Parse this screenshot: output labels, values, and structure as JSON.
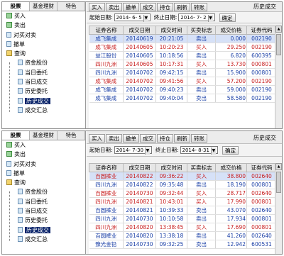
{
  "top": {
    "left_tabs": [
      "股票",
      "基金理财",
      "特色"
    ],
    "tree": [
      {
        "label": "买入",
        "level": 0,
        "icon": "buy-icon"
      },
      {
        "label": "卖出",
        "level": 0,
        "icon": "sell-icon"
      },
      {
        "label": "对买对卖",
        "level": 0,
        "icon": "doc-icon"
      },
      {
        "label": "撤单",
        "level": 0,
        "icon": "doc-icon"
      },
      {
        "label": "查询",
        "level": 0,
        "icon": "folder-icon"
      },
      {
        "label": "资金股份",
        "level": 1,
        "icon": "doc-icon"
      },
      {
        "label": "当日委托",
        "level": 1,
        "icon": "doc-icon"
      },
      {
        "label": "当日成交",
        "level": 1,
        "icon": "doc-icon"
      },
      {
        "label": "历史委托",
        "level": 1,
        "icon": "doc-icon"
      },
      {
        "label": "历史成交",
        "level": 1,
        "icon": "doc-icon",
        "selected": true
      },
      {
        "label": "成交汇总",
        "level": 1,
        "icon": "doc-icon"
      }
    ],
    "toolbar": [
      "买入",
      "卖出",
      "撤单",
      "成交",
      "持仓",
      "刷新",
      "转账"
    ],
    "title": "历史成交",
    "filter": {
      "start_label": "起始日期:",
      "start_date": "2014- 6- 5",
      "end_label": "终止日期:",
      "end_date": "2014- 7- 2",
      "query": "确定"
    },
    "columns": [
      "证券名称",
      "成交日期",
      "成交时间",
      "买卖标志",
      "成交价格",
      "证券代码"
    ],
    "rows": [
      [
        "成飞集成",
        "20140619",
        "20:21:05",
        "卖出",
        "0.000",
        "002190"
      ],
      [
        "成飞集成",
        "20140605",
        "10:20:23",
        "买入",
        "29.250",
        "002190"
      ],
      [
        "益江股份",
        "20140605",
        "10:18:56",
        "卖出",
        "6.820",
        "600395"
      ],
      [
        "四川九洲",
        "20140605",
        "10:17:31",
        "买入",
        "13.730",
        "000801"
      ],
      [
        "四川九洲",
        "20140702",
        "09:42:15",
        "卖出",
        "15.900",
        "000801"
      ],
      [
        "成飞集成",
        "20140702",
        "09:41:56",
        "买入",
        "57.200",
        "002190"
      ],
      [
        "成飞集成",
        "20140702",
        "09:40:23",
        "卖出",
        "59.000",
        "002190"
      ],
      [
        "成飞集成",
        "20140702",
        "09:40:04",
        "卖出",
        "58.580",
        "002190"
      ]
    ]
  },
  "bottom": {
    "left_tabs": [
      "股票",
      "基金理财",
      "特色"
    ],
    "tree": [
      {
        "label": "买入",
        "level": 0,
        "icon": "buy-icon"
      },
      {
        "label": "卖出",
        "level": 0,
        "icon": "sell-icon"
      },
      {
        "label": "对买对卖",
        "level": 0,
        "icon": "doc-icon"
      },
      {
        "label": "撤单",
        "level": 0,
        "icon": "doc-icon"
      },
      {
        "label": "查询",
        "level": 0,
        "icon": "folder-icon"
      },
      {
        "label": "资金股份",
        "level": 1,
        "icon": "doc-icon"
      },
      {
        "label": "当日委托",
        "level": 1,
        "icon": "doc-icon"
      },
      {
        "label": "当日成交",
        "level": 1,
        "icon": "doc-icon"
      },
      {
        "label": "历史委托",
        "level": 1,
        "icon": "doc-icon"
      },
      {
        "label": "历史成交",
        "level": 1,
        "icon": "doc-icon",
        "selected": true
      },
      {
        "label": "成交汇总",
        "level": 1,
        "icon": "doc-icon"
      }
    ],
    "toolbar": [
      "买入",
      "卖出",
      "撤单",
      "成交",
      "持仓",
      "刷新",
      "转账"
    ],
    "title": "历史成交",
    "filter": {
      "start_label": "起始日期:",
      "start_date": "2014- 7-30",
      "end_label": "终止日期:",
      "end_date": "2014- 8-31",
      "query": "确定"
    },
    "columns": [
      "证券名称",
      "成交日期",
      "成交时间",
      "买卖标志",
      "成交价格",
      "证券代码"
    ],
    "rows": [
      [
        "百圆裤业",
        "20140822",
        "09:36:22",
        "买入",
        "38.800",
        "002640"
      ],
      [
        "四川九洲",
        "20140822",
        "09:35:48",
        "卖出",
        "18.190",
        "000801"
      ],
      [
        "百圆裤业",
        "20140730",
        "09:32:44",
        "买入",
        "28.717",
        "002640"
      ],
      [
        "四川九洲",
        "20140821",
        "10:43:01",
        "买入",
        "17.990",
        "000801"
      ],
      [
        "百圆裤业",
        "20140821",
        "10:39:33",
        "卖出",
        "43.070",
        "002640"
      ],
      [
        "四川九洲",
        "20140730",
        "10:10:58",
        "卖出",
        "17.934",
        "000801"
      ],
      [
        "四川九洲",
        "20140820",
        "13:38:45",
        "买入",
        "17.690",
        "000801"
      ],
      [
        "百圆裤业",
        "20140820",
        "13:38:18",
        "卖出",
        "41.260",
        "002640"
      ],
      [
        "豫光金铅",
        "20140730",
        "09:32:25",
        "卖出",
        "12.942",
        "600531"
      ]
    ]
  },
  "colors": {
    "buy": "#c81e1e",
    "sell": "#1a3fa6",
    "selection": "#0a246a"
  }
}
